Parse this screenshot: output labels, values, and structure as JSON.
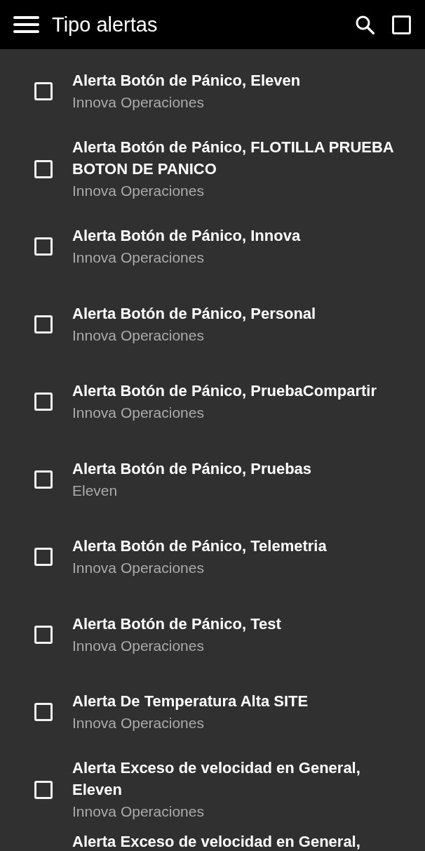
{
  "app_bar": {
    "title": "Tipo alertas",
    "select_all": {
      "checked": false
    }
  },
  "alerts": [
    {
      "title": "Alerta Botón de Pánico, Eleven",
      "subtitle": "Innova Operaciones",
      "checked": false
    },
    {
      "title": "Alerta Botón de Pánico, FLOTILLA PRUEBA BOTON DE PANICO",
      "subtitle": "Innova Operaciones",
      "checked": false
    },
    {
      "title": "Alerta Botón de Pánico, Innova",
      "subtitle": "Innova Operaciones",
      "checked": false
    },
    {
      "title": "Alerta Botón de Pánico, Personal",
      "subtitle": "Innova Operaciones",
      "checked": false
    },
    {
      "title": "Alerta Botón de Pánico, PruebaCompartir",
      "subtitle": "Innova Operaciones",
      "checked": false
    },
    {
      "title": "Alerta Botón de Pánico, Pruebas",
      "subtitle": "Eleven",
      "checked": false
    },
    {
      "title": "Alerta Botón de Pánico, Telemetria",
      "subtitle": "Innova Operaciones",
      "checked": false
    },
    {
      "title": "Alerta Botón de Pánico, Test",
      "subtitle": "Innova Operaciones",
      "checked": false
    },
    {
      "title": "Alerta De Temperatura Alta SITE",
      "subtitle": "Innova Operaciones",
      "checked": false
    },
    {
      "title": "Alerta Exceso de velocidad en General, Eleven",
      "subtitle": "Innova Operaciones",
      "checked": false
    }
  ],
  "cut_off_item": {
    "title": "Alerta Exceso de velocidad en General,"
  }
}
